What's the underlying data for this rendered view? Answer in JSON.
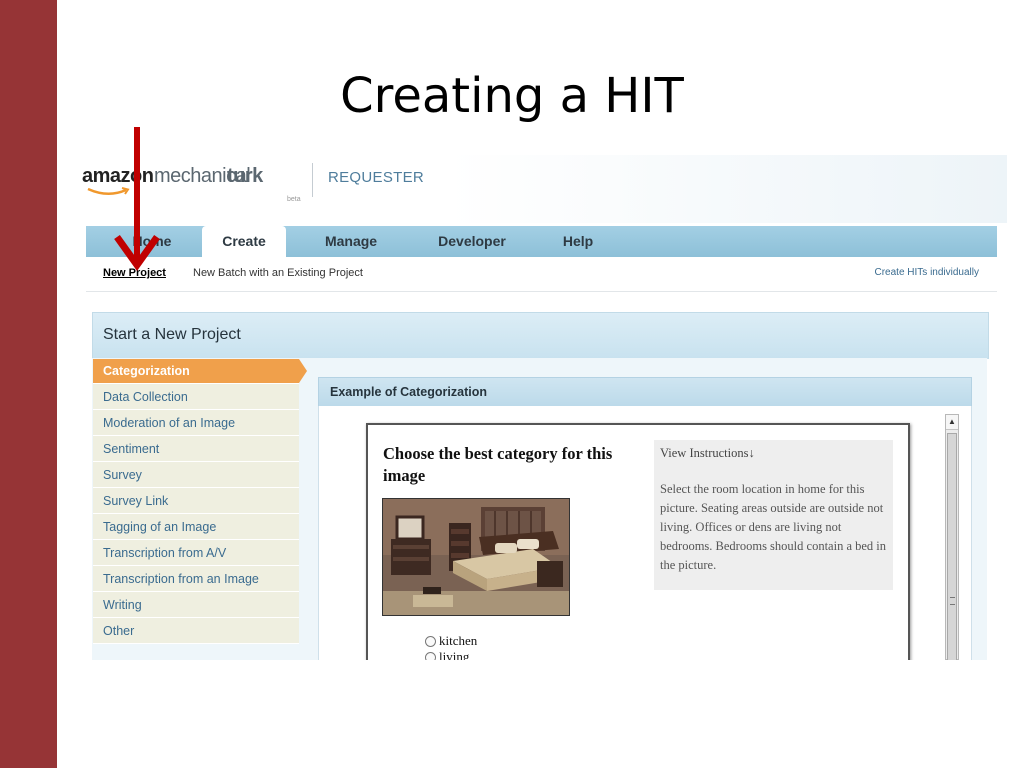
{
  "slide": {
    "title": "Creating a HIT"
  },
  "colors": {
    "slide_accent": "#963436",
    "arrow": "#c00000",
    "active_tab_bg": "#ffffff",
    "active_category": "#f0a04b",
    "nav_bar": "#9ccbe0"
  },
  "header": {
    "logo": {
      "amazon": "amazon",
      "mechanical": "mechanical",
      "turk": "turk",
      "beta": "beta"
    },
    "section": "REQUESTER"
  },
  "nav": {
    "tabs": [
      {
        "label": "Home",
        "active": false
      },
      {
        "label": "Create",
        "active": true
      },
      {
        "label": "Manage",
        "active": false
      },
      {
        "label": "Developer",
        "active": false
      },
      {
        "label": "Help",
        "active": false
      }
    ]
  },
  "subnav": {
    "new_project": "New Project",
    "new_batch": "New Batch with an Existing Project",
    "create_individually": "Create HITs individually"
  },
  "panel": {
    "title": "Start a New Project"
  },
  "categories": [
    {
      "label": "Categorization",
      "active": true
    },
    {
      "label": "Data Collection"
    },
    {
      "label": "Moderation of an Image"
    },
    {
      "label": "Sentiment"
    },
    {
      "label": "Survey"
    },
    {
      "label": "Survey Link"
    },
    {
      "label": "Tagging of an Image"
    },
    {
      "label": "Transcription from A/V"
    },
    {
      "label": "Transcription from an Image"
    },
    {
      "label": "Writing"
    },
    {
      "label": "Other"
    }
  ],
  "example": {
    "title": "Example of Categorization",
    "question": "Choose the best category for this image",
    "image_alt": "bedroom-photo",
    "options": [
      "kitchen",
      "living"
    ],
    "instructions_link": "View Instructions",
    "instructions_arrow": "↓",
    "instructions_text": "Select the room location in home for this picture. Seating areas outside are outside not living. Offices or dens are living not bedrooms. Bedrooms should contain a bed in the picture."
  },
  "icons": {
    "arrow": "down-arrow-icon",
    "scroll_up": "scroll-up-icon",
    "radio": "radio-icon"
  }
}
